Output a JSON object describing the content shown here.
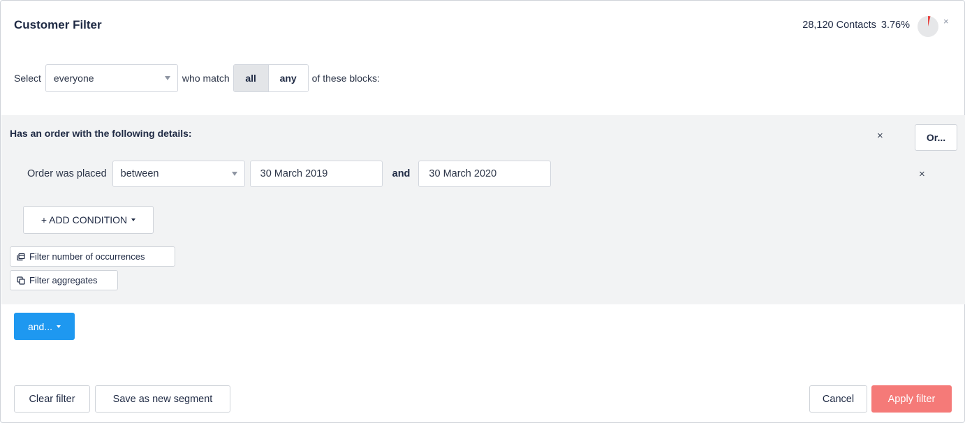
{
  "header": {
    "title": "Customer Filter",
    "contacts_count": "28,120 Contacts",
    "contacts_percent": "3.76%",
    "percent_value": 3.76,
    "close_label": "×"
  },
  "selector": {
    "select_label": "Select",
    "audience_value": "everyone",
    "who_match_label": "who match",
    "match_options": [
      "all",
      "any"
    ],
    "match_selected": "all",
    "of_blocks_label": "of these blocks:"
  },
  "block": {
    "title": "Has an order with the following details:",
    "close_label": "×",
    "or_label": "Or...",
    "condition": {
      "label": "Order was placed",
      "operator_value": "between",
      "date_from": "30 March 2019",
      "and_label": "and",
      "date_to": "30 March 2020",
      "close_label": "×"
    },
    "add_condition_label": "+ ADD CONDITION",
    "filter_occurrences_label": "Filter number of occurrences",
    "filter_aggregates_label": "Filter aggregates"
  },
  "and_button_label": "and...",
  "footer": {
    "clear_label": "Clear filter",
    "save_segment_label": "Save as new segment",
    "cancel_label": "Cancel",
    "apply_label": "Apply filter"
  },
  "colors": {
    "primary_blue": "#1e98f0",
    "apply_red": "#f57a78",
    "block_bg": "#f2f3f4",
    "pie_slice": "#e8413e",
    "pie_bg": "#e6e7e9"
  },
  "icons": {
    "occurrences": "calendar-copy-icon",
    "aggregates": "copy-icon",
    "close": "close-icon",
    "caret": "chevron-down-icon",
    "pie": "pie-chart-icon"
  }
}
